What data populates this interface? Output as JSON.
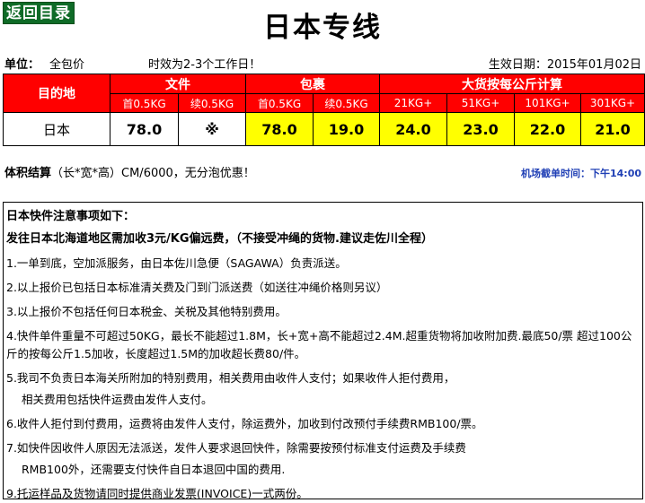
{
  "nav": {
    "back_label": "返回目录"
  },
  "page": {
    "title": "日本专线"
  },
  "meta": {
    "unit_label": "单位：",
    "unit_value": "全包价",
    "timing": "时效为2-3个工作日！",
    "effective_date": "生效日期：2015年01月02日"
  },
  "rate_table": {
    "destination_header": "目的地",
    "group_headers": [
      "文件",
      "包裹",
      "大货按每公斤计算"
    ],
    "sub_headers": [
      "首0.5KG",
      "续0.5KG",
      "首0.5KG",
      "续0.5KG",
      "21KG+",
      "51KG+",
      "101KG+",
      "301KG+"
    ],
    "rows": [
      {
        "destination": "日本",
        "values": [
          "78.0",
          "※",
          "78.0",
          "19.0",
          "24.0",
          "23.0",
          "22.0",
          "21.0"
        ]
      }
    ]
  },
  "volume": {
    "label": "体积结算",
    "formula": "（长*宽*高）CM/6000，无分泡优惠！"
  },
  "cutoff": {
    "text": "机场截单时间：下午14:00"
  },
  "notes": {
    "heading": "日本快件注意事项如下：",
    "remote": "发往日本北海道地区需加收3元/KG偏远费，（不接受冲绳的货物.建议走佐川全程）",
    "items": [
      "1.一单到底，空加派服务，由日本佐川急便（SAGAWA）负责派送。",
      "2.以上报价已包括日本标准清关费及门到门派送费（如送往冲绳价格则另议）",
      "3.以上报价不包括任何日本税金、关税及其他特别费用。",
      "4.快件单件重量不可超过50KG，最长不能超过1.8M，长+宽+高不能超过2.4M.超重货物将加收附加费.最底50/票 超过100公斤的按每公斤1.5加收，长度超过1.5M的加收超长费80/件。",
      "5.我司不负责日本海关所附加的特别费用，相关费用由收件人支付；如果收件人拒付费用，",
      "相关费用包括快件运费由发件人支付。",
      "6.收件人拒付到付费用，运费将由发件人支付，除运费外，加收到付改预付手续费RMB100/票。",
      "7.如快件因收件人原因无法派送，发件人要求退回快件，除需要按预付标准支付运费及手续费",
      "RMB100外，还需要支付快件自日本退回中国的费用.",
      "9.托运样品及货物请同时提供商业发票(INVOICE)一式两份。"
    ]
  },
  "colors": {
    "header_red": "#ff0000",
    "highlight_yellow": "#ffff00",
    "button_green": "#0f6b27",
    "cutoff_blue": "#1f3fb5"
  }
}
